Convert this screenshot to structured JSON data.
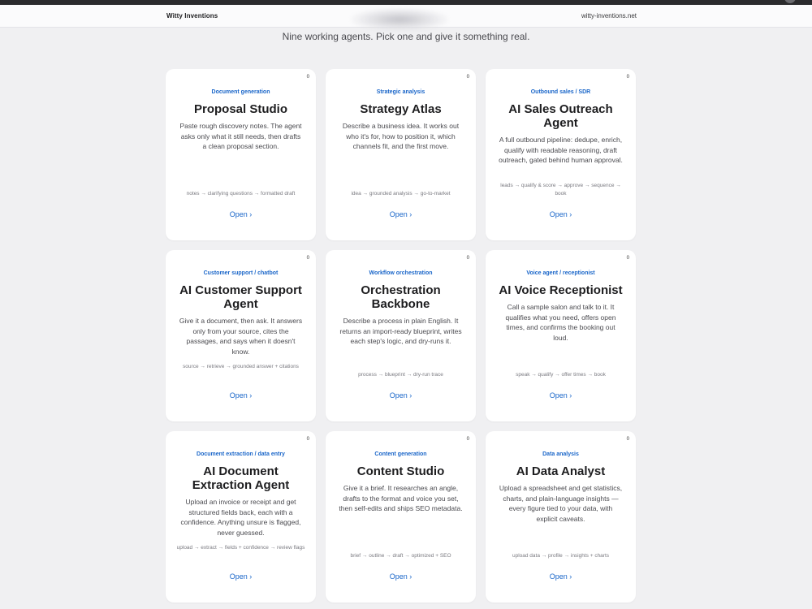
{
  "header": {
    "brand": "Witty Inventions",
    "site": "witty-inventions.net"
  },
  "subtitle": "Nine working agents. Pick one and give it something real.",
  "cards": [
    {
      "counter": "0",
      "category": "Document generation",
      "title": "Proposal Studio",
      "description": "Paste rough discovery notes. The agent asks only what it still needs, then drafts a clean proposal section.",
      "pipeline": "notes → clarifying questions → formatted draft",
      "link": "Open ›"
    },
    {
      "counter": "0",
      "category": "Strategic analysis",
      "title": "Strategy Atlas",
      "description": "Describe a business idea. It works out who it's for, how to position it, which channels fit, and the first move.",
      "pipeline": "idea → grounded analysis → go-to-market",
      "link": "Open ›"
    },
    {
      "counter": "0",
      "category": "Outbound sales / SDR",
      "title": "AI Sales Outreach Agent",
      "description": "A full outbound pipeline: dedupe, enrich, qualify with readable reasoning, draft outreach, gated behind human approval.",
      "pipeline": "leads → qualify & score → approve → sequence → book",
      "link": "Open ›"
    },
    {
      "counter": "0",
      "category": "Customer support / chatbot",
      "title": "AI Customer Support Agent",
      "description": "Give it a document, then ask. It answers only from your source, cites the passages, and says when it doesn't know.",
      "pipeline": "source → retrieve → grounded answer + citations",
      "link": "Open ›"
    },
    {
      "counter": "0",
      "category": "Workflow orchestration",
      "title": "Orchestration Backbone",
      "description": "Describe a process in plain English. It returns an import-ready blueprint, writes each step's logic, and dry-runs it.",
      "pipeline": "process → blueprint → dry-run trace",
      "link": "Open ›"
    },
    {
      "counter": "0",
      "category": "Voice agent / receptionist",
      "title": "AI Voice Receptionist",
      "description": "Call a sample salon and talk to it. It qualifies what you need, offers open times, and confirms the booking out loud.",
      "pipeline": "speak → qualify → offer times → book",
      "link": "Open ›"
    },
    {
      "counter": "0",
      "category": "Document extraction / data entry",
      "title": "AI Document Extraction Agent",
      "description": "Upload an invoice or receipt and get structured fields back, each with a confidence. Anything unsure is flagged, never guessed.",
      "pipeline": "upload → extract → fields + confidence → review flags",
      "link": "Open ›"
    },
    {
      "counter": "0",
      "category": "Content generation",
      "title": "Content Studio",
      "description": "Give it a brief. It researches an angle, drafts to the format and voice you set, then self-edits and ships SEO metadata.",
      "pipeline": "brief → outline → draft → optimized + SEO",
      "link": "Open ›"
    },
    {
      "counter": "0",
      "category": "Data analysis",
      "title": "AI Data Analyst",
      "description": "Upload a spreadsheet and get statistics, charts, and plain-language insights — every figure tied to your data, with explicit caveats.",
      "pipeline": "upload data → profile → insights + charts",
      "link": "Open ›"
    }
  ]
}
